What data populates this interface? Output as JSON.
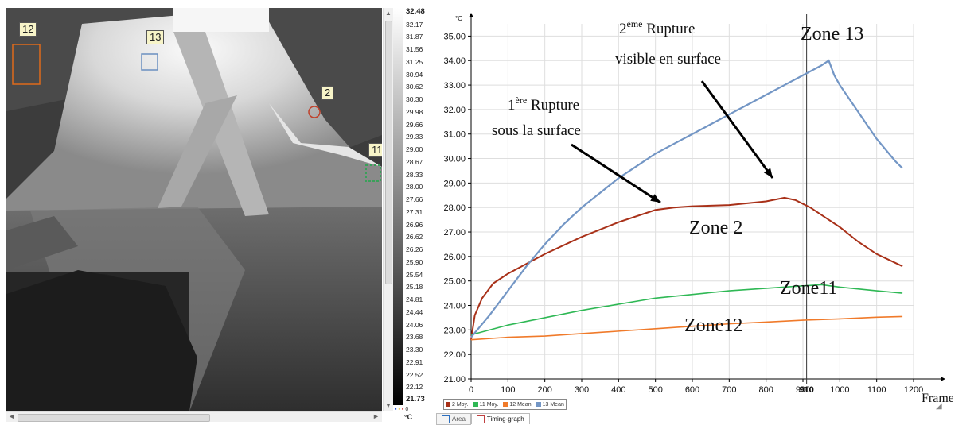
{
  "thermal": {
    "zones": [
      {
        "id": "12",
        "label": "12",
        "color": "#e06a1a"
      },
      {
        "id": "13",
        "label": "13",
        "color": "#6a8fc0"
      },
      {
        "id": "2",
        "label": "2",
        "color": "#c0402a"
      },
      {
        "id": "11",
        "label": "11",
        "color": "#3aa05a"
      }
    ]
  },
  "colorscale": {
    "unit": "°C",
    "max": "32.48",
    "min": "21.73",
    "labels": [
      "32.48",
      "32.17",
      "31.87",
      "31.56",
      "31.25",
      "30.94",
      "30.62",
      "30.30",
      "29.98",
      "29.66",
      "29.33",
      "29.00",
      "28.67",
      "28.33",
      "28.00",
      "27.66",
      "27.31",
      "26.96",
      "26.62",
      "26.26",
      "25.90",
      "25.54",
      "25.18",
      "24.81",
      "24.44",
      "24.06",
      "23.68",
      "23.30",
      "22.91",
      "22.52",
      "22.12",
      "21.73"
    ],
    "palette_value": "0"
  },
  "chart_data": {
    "type": "line",
    "ylabel": "°C",
    "xlabel": "Frames",
    "xlim": [
      0,
      1200
    ],
    "ylim": [
      21,
      35.5
    ],
    "xticks": [
      "0",
      "100",
      "200",
      "300",
      "400",
      "500",
      "600",
      "700",
      "800",
      "900",
      "1000",
      "1100",
      "1200"
    ],
    "yticks": [
      "21.00",
      "22.00",
      "23.00",
      "24.00",
      "25.00",
      "26.00",
      "27.00",
      "28.00",
      "29.00",
      "30.00",
      "31.00",
      "32.00",
      "33.00",
      "34.00",
      "35.00"
    ],
    "cursor_x": 910,
    "cursor_label": "910",
    "series": [
      {
        "name": "2 Moy.",
        "color": "#a83018",
        "points": [
          [
            0,
            22.6
          ],
          [
            10,
            23.6
          ],
          [
            30,
            24.3
          ],
          [
            60,
            24.9
          ],
          [
            100,
            25.3
          ],
          [
            150,
            25.7
          ],
          [
            200,
            26.1
          ],
          [
            300,
            26.8
          ],
          [
            400,
            27.4
          ],
          [
            500,
            27.9
          ],
          [
            550,
            28.0
          ],
          [
            600,
            28.05
          ],
          [
            700,
            28.1
          ],
          [
            800,
            28.25
          ],
          [
            850,
            28.4
          ],
          [
            880,
            28.3
          ],
          [
            920,
            28.0
          ],
          [
            960,
            27.6
          ],
          [
            1000,
            27.2
          ],
          [
            1050,
            26.6
          ],
          [
            1100,
            26.1
          ],
          [
            1170,
            25.6
          ]
        ]
      },
      {
        "name": "11 Moy.",
        "color": "#2fb855",
        "points": [
          [
            0,
            22.8
          ],
          [
            50,
            23.0
          ],
          [
            100,
            23.2
          ],
          [
            200,
            23.5
          ],
          [
            300,
            23.8
          ],
          [
            400,
            24.05
          ],
          [
            500,
            24.3
          ],
          [
            600,
            24.45
          ],
          [
            700,
            24.6
          ],
          [
            800,
            24.7
          ],
          [
            900,
            24.8
          ],
          [
            950,
            24.85
          ],
          [
            1000,
            24.75
          ],
          [
            1100,
            24.6
          ],
          [
            1170,
            24.5
          ]
        ]
      },
      {
        "name": "12 Mean",
        "color": "#f07a2a",
        "points": [
          [
            0,
            22.6
          ],
          [
            100,
            22.7
          ],
          [
            200,
            22.75
          ],
          [
            300,
            22.85
          ],
          [
            400,
            22.95
          ],
          [
            500,
            23.05
          ],
          [
            600,
            23.15
          ],
          [
            700,
            23.25
          ],
          [
            800,
            23.32
          ],
          [
            900,
            23.4
          ],
          [
            1000,
            23.45
          ],
          [
            1100,
            23.52
          ],
          [
            1170,
            23.55
          ]
        ]
      },
      {
        "name": "13 Mean",
        "color": "#7396c5",
        "points": [
          [
            0,
            22.7
          ],
          [
            50,
            23.6
          ],
          [
            100,
            24.6
          ],
          [
            150,
            25.6
          ],
          [
            200,
            26.5
          ],
          [
            250,
            27.3
          ],
          [
            300,
            28.0
          ],
          [
            350,
            28.6
          ],
          [
            400,
            29.2
          ],
          [
            450,
            29.7
          ],
          [
            500,
            30.2
          ],
          [
            550,
            30.6
          ],
          [
            600,
            31.0
          ],
          [
            650,
            31.4
          ],
          [
            700,
            31.8
          ],
          [
            750,
            32.2
          ],
          [
            800,
            32.6
          ],
          [
            850,
            33.0
          ],
          [
            900,
            33.4
          ],
          [
            950,
            33.8
          ],
          [
            970,
            34.0
          ],
          [
            985,
            33.4
          ],
          [
            1000,
            33.0
          ],
          [
            1050,
            31.9
          ],
          [
            1100,
            30.8
          ],
          [
            1150,
            29.9
          ],
          [
            1170,
            29.6
          ]
        ]
      }
    ],
    "annotations": [
      {
        "id": "rupture2",
        "line1_sup": "ème",
        "line1_pre": "2",
        "line1_post": " Rupture",
        "line2": "visible en surface"
      },
      {
        "id": "rupture1",
        "line1_sup": "ère",
        "line1_pre": "1",
        "line1_post": " Rupture",
        "line2": "sous la surface"
      }
    ],
    "zone_labels": [
      "Zone 13",
      "Zone 2",
      "Zone11",
      "Zone12"
    ]
  },
  "tabs": [
    {
      "label": "Area"
    },
    {
      "label": "Timing-graph"
    }
  ]
}
